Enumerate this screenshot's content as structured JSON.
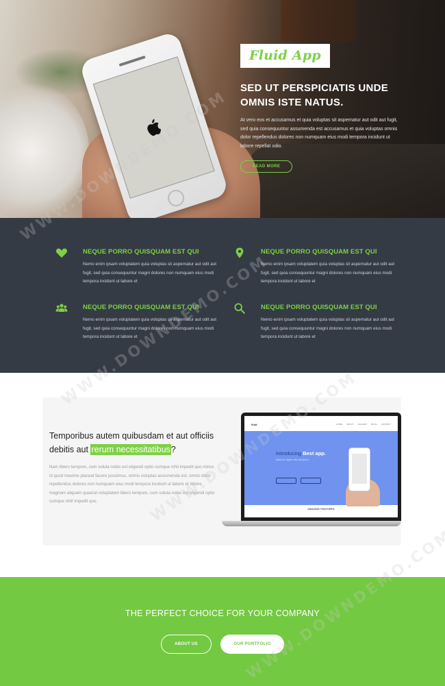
{
  "hero": {
    "brand": "Fluid App",
    "title_line1": "SED UT PERSPICIATIS UNDE",
    "title_line2": "OMNIS ISTE NATUS.",
    "text": "At vero eos et accusamus et quia voluptas sit aspernatur aut odit aut fugit, sed quia consequuntur assumenda est accusamus et quia voluptas omnis dolor repellendus dolores non numquam eius modi tempora incidunt ut labore repellat odio.",
    "read_more_label": "READ MORE"
  },
  "features": [
    {
      "icon": "heart-icon",
      "title": "NEQUE PORRO QUISQUAM EST QUI",
      "text": "Nemo enim ipsam voluptatem quia voluptas sit aspernatur aut odit aut fugit, sed quia consequuntur magni dolores non numquam eius modi tempora incidunt ut labore et"
    },
    {
      "icon": "map-marker-icon",
      "title": "NEQUE PORRO QUISQUAM EST QUI",
      "text": "Nemo enim ipsam voluptatem quia voluptas sit aspernatur aut odit aut fugit, sed quia consequuntur magni dolores non numquam eius modi tempora incidunt ut labore et"
    },
    {
      "icon": "users-icon",
      "title": "NEQUE PORRO QUISQUAM EST QUI",
      "text": "Nemo enim ipsam voluptatem quia voluptas sit aspernatur aut odit aut fugit, sed quia consequuntur magni dolores non numquam eius modi tempora incidunt ut labore et"
    },
    {
      "icon": "search-icon",
      "title": "NEQUE PORRO QUISQUAM EST QUI",
      "text": "Nemo enim ipsam voluptatem quia voluptas sit aspernatur aut odit aut fugit, sed quia consequuntur magni dolores non numquam eius modi tempora incidunt ut labore et"
    }
  ],
  "intro": {
    "heading_part1": "Temporibus autem quibusdam et aut officiis debitis aut ",
    "heading_highlight": "rerum necessitatibus",
    "heading_part2": "?",
    "text": "Nam libero tempore, cum soluta nobis est eligendi optio cumque nihil impedit quo minus id quod maxime placeat facere possimus, omnis voluptas assumenda est, omnis dolor repellendus dolores non numquam eius modi tempora incidunt ut labore et dolore magnam aliquam quaerat voluptatem libero tempore, cum soluta nobis est eligendi optio cumque nihil impedit quo.",
    "laptop_screen": {
      "logo": "fluid",
      "nav": [
        "HOME",
        "ABOUT",
        "GALLERY",
        "BLOG",
        "CONTACT"
      ],
      "title_prefix": "Introducing",
      "title_bold": "Best app.",
      "subtitle": "Mauris et, sapien velit, erat ipsum",
      "features_label": "AMAZING FEATURES"
    }
  },
  "cta": {
    "title": "THE PERFECT CHOICE FOR YOUR COMPANY",
    "about_label": "ABOUT US",
    "portfolio_label": "OUR PORTFOLIO"
  },
  "colors": {
    "accent": "#7ed045",
    "dark": "#343b45",
    "cta_bg": "#73c941"
  },
  "watermark": "WWW.DOWNDEMO.COM"
}
